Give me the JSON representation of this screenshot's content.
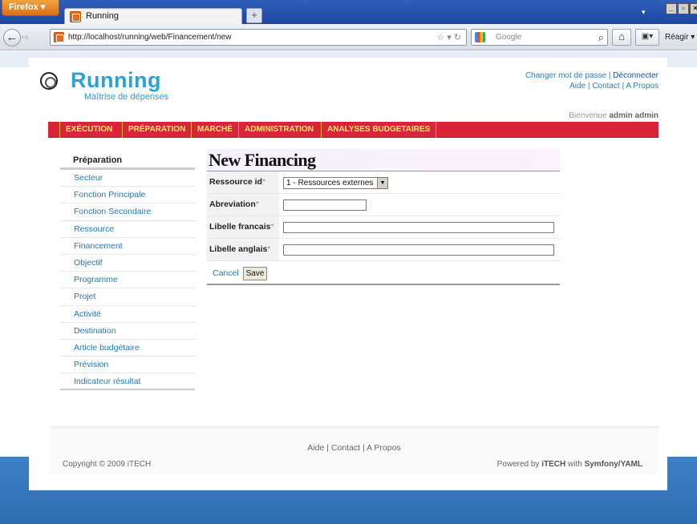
{
  "browser": {
    "app_button": "Firefox",
    "tab_title": "Running",
    "new_tab": "+",
    "url": "http://localhost/running/web/Financement/new",
    "search_placeholder": "Google",
    "addon_label": "Réagir"
  },
  "header": {
    "logo_title": "Running",
    "logo_subtitle": "Maîtrise de dépenses",
    "link_change_password": "Changer mot de passe",
    "link_logout": "Déconnecter",
    "link_help": "Aide",
    "link_contact": "Contact",
    "link_about": "A Propos",
    "separator": "|",
    "welcome_text": "Bienvenue",
    "welcome_user": "admin admin"
  },
  "menu": {
    "items": [
      "EXÉCUTION",
      "PRÉPARATION",
      "MARCHÉ",
      "ADMINISTRATION",
      "ANALYSES BUDGETAIRES"
    ]
  },
  "sidebar": {
    "heading": "Préparation",
    "items": [
      "Secteur",
      "Fonction Principale",
      "Fonction Secondaire",
      "Ressource",
      "Financement",
      "Objectif",
      "Programme",
      "Projet",
      "Activité",
      "Destination",
      "Article budgétaire",
      "Prévision",
      "Indicateur résultat"
    ]
  },
  "form": {
    "title": "New Financing",
    "required_mark": "*",
    "fields": [
      {
        "label": "Ressource id",
        "value": "1 - Ressources externes"
      },
      {
        "label": "Abreviation",
        "value": ""
      },
      {
        "label": "Libelle francais",
        "value": ""
      },
      {
        "label": "Libelle anglais",
        "value": ""
      }
    ],
    "cancel_label": "Cancel",
    "save_label": "Save"
  },
  "footer": {
    "link_help": "Aide",
    "link_contact": "Contact",
    "link_about": "A Propos",
    "copyright": "Copyright © 2009 iTECH",
    "powered_prefix": "Powered by",
    "powered_company": "iTECH",
    "powered_middle": "with",
    "powered_tech": "Symfony/YAML"
  },
  "colors": {
    "menu_bar": "#d9253a",
    "menu_text": "#ffe96a",
    "logo": "#28a3d6",
    "link": "#2378be",
    "page_background": "#3f7fc4"
  }
}
